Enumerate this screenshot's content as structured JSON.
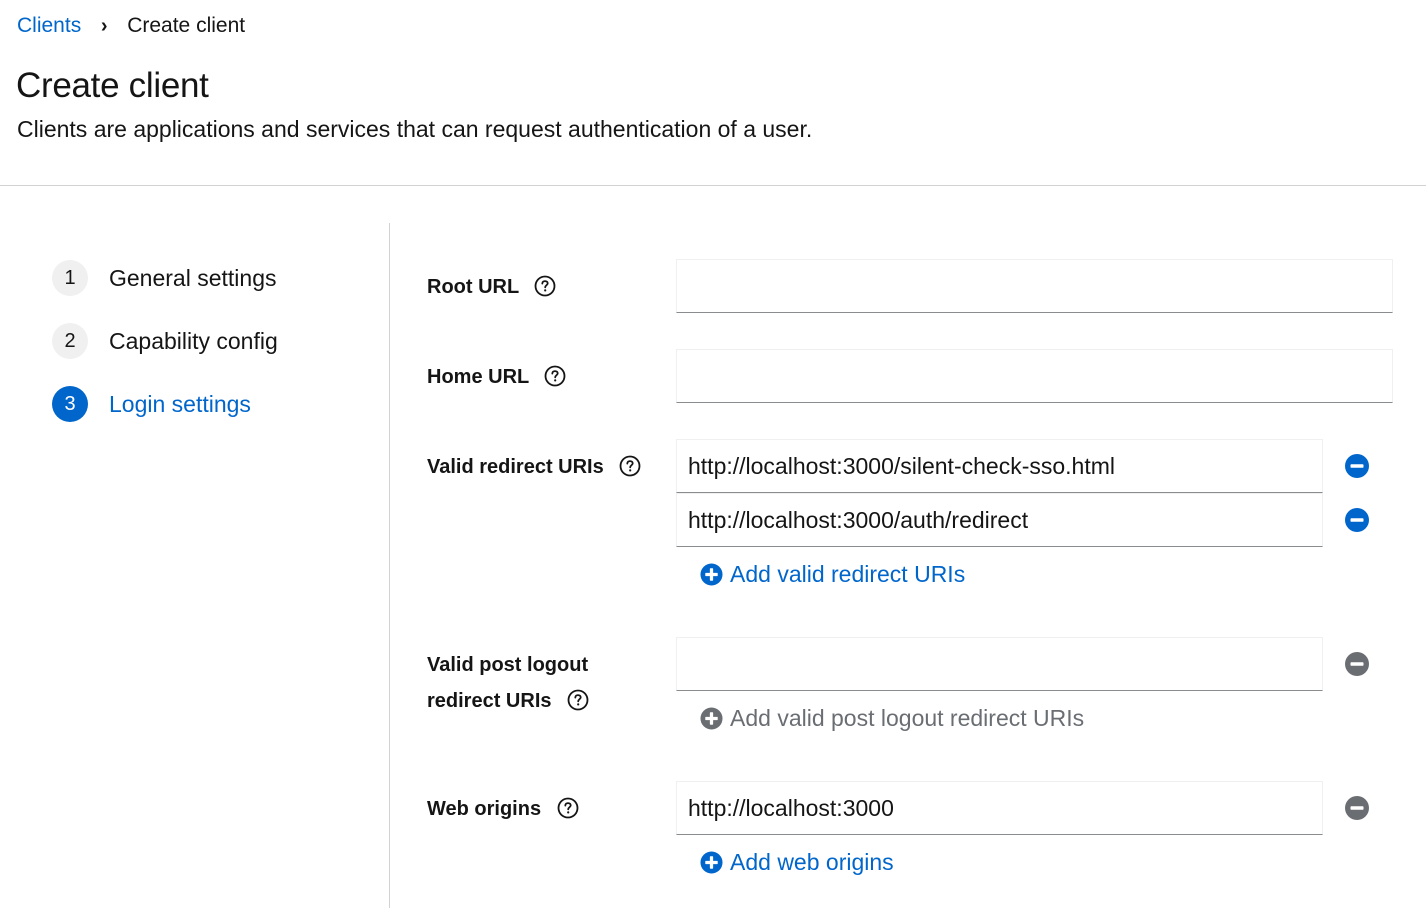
{
  "breadcrumb": {
    "parent": "Clients",
    "separator": "›",
    "current": "Create client"
  },
  "page": {
    "title": "Create client",
    "description": "Clients are applications and services that can request authentication of a user."
  },
  "wizard": {
    "steps": [
      {
        "number": "1",
        "label": "General settings",
        "current": false
      },
      {
        "number": "2",
        "label": "Capability config",
        "current": false
      },
      {
        "number": "3",
        "label": "Login settings",
        "current": true
      }
    ]
  },
  "form": {
    "root_url": {
      "label": "Root URL",
      "value": ""
    },
    "home_url": {
      "label": "Home URL",
      "value": ""
    },
    "valid_redirect_uris": {
      "label": "Valid redirect URIs",
      "values": [
        "http://localhost:3000/silent-check-sso.html",
        "http://localhost:3000/auth/redirect"
      ],
      "add_label": "Add valid redirect URIs"
    },
    "valid_post_logout_redirect_uris": {
      "label_line1": "Valid post logout",
      "label_line2": "redirect URIs",
      "values": [
        ""
      ],
      "add_label": "Add valid post logout redirect URIs",
      "add_enabled": false
    },
    "web_origins": {
      "label": "Web origins",
      "values": [
        "http://localhost:3000"
      ],
      "add_label": "Add web origins"
    }
  },
  "colors": {
    "link_blue": "#0066cc",
    "disabled_gray": "#6a6e73",
    "text": "#151515",
    "border": "#d2d2d2"
  },
  "icons": {
    "help": "help-circle-icon",
    "remove_active": "minus-circle-icon",
    "remove_disabled": "minus-circle-icon",
    "add": "plus-circle-icon"
  }
}
